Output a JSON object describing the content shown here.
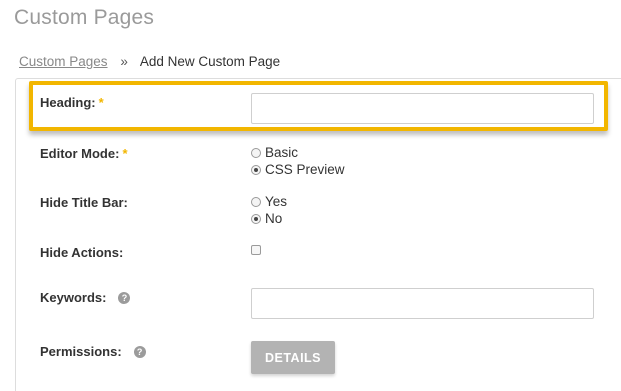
{
  "page": {
    "title": "Custom Pages"
  },
  "breadcrumb": {
    "parent": "Custom Pages",
    "separator": "»",
    "current": "Add New Custom Page"
  },
  "form": {
    "heading": {
      "label": "Heading:",
      "required_mark": "*",
      "value": ""
    },
    "editor_mode": {
      "label": "Editor Mode:",
      "required_mark": "*",
      "options": [
        {
          "label": "Basic",
          "checked": false
        },
        {
          "label": "CSS Preview",
          "checked": true
        }
      ]
    },
    "hide_title_bar": {
      "label": "Hide Title Bar:",
      "options": [
        {
          "label": "Yes",
          "checked": false
        },
        {
          "label": "No",
          "checked": true
        }
      ]
    },
    "hide_actions": {
      "label": "Hide Actions:",
      "checked": false
    },
    "keywords": {
      "label": "Keywords:",
      "help": "?",
      "value": ""
    },
    "permissions": {
      "label": "Permissions:",
      "help": "?",
      "button_label": "DETAILS"
    }
  },
  "colors": {
    "highlight": "#f2b600",
    "required": "#f2b600",
    "button_bg": "#b3b3b3",
    "title": "#9a9a9a"
  },
  "icons": {
    "help": "question-circle-icon",
    "breadcrumb_separator": "double-chevron"
  }
}
